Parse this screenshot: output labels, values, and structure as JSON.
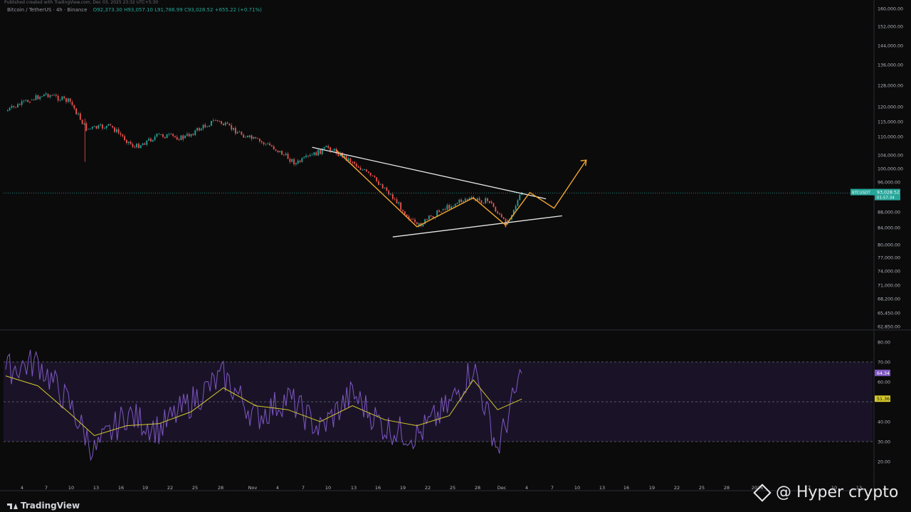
{
  "header": {
    "top_line": "Published created with TradingView.com, Dec 03, 2025 23:32 UTC+5:30",
    "symbol": "Bitcoin / TetherUS · 4h · Binance",
    "o": "O92,373.30",
    "h": "H93,057.10",
    "l": "L91,786.99",
    "c": "C93,028.52",
    "change": "+655.22 (+0.71%)"
  },
  "brand": {
    "logo_text": "TradingView",
    "watermark": "@ Hyper crypto"
  },
  "colors": {
    "background": "#0b0b0b",
    "up": "#26a69a",
    "down": "#ef5350",
    "pattern": "#f0a531",
    "trendline": "#e6e6e6",
    "rsi": "#7e57c2",
    "rsi_ma": "#d4c82b",
    "rsi_band": "#1e1530"
  },
  "price_axis": {
    "ticks": [
      "160,000.00",
      "152,000.00",
      "144,000.00",
      "136,000.00",
      "128,000.00",
      "120,000.00",
      "115,000.00",
      "110,000.00",
      "104,000.00",
      "100,000.00",
      "96,000.00",
      "88,000.00",
      "84,000.00",
      "80,000.00",
      "77,000.00",
      "74,000.00",
      "71,000.00",
      "68,200.00",
      "65,450.00",
      "62,850.00"
    ],
    "current_label": {
      "symbol": "BTCUSDT",
      "price": "93,028.52",
      "countdown": "01:57:34"
    }
  },
  "rsi_axis": {
    "ticks": [
      "80.00",
      "70.00",
      "60.00",
      "40.00",
      "30.00",
      "20.00"
    ],
    "rsi_value": "64.34",
    "ma_value": "51.36"
  },
  "time_axis": {
    "labels": [
      "4",
      "7",
      "10",
      "13",
      "16",
      "19",
      "22",
      "25",
      "28",
      "Nov",
      "4",
      "7",
      "10",
      "13",
      "16",
      "19",
      "22",
      "25",
      "28",
      "Dec",
      "4",
      "7",
      "10",
      "13",
      "16",
      "19",
      "22",
      "25",
      "28",
      "2026",
      "7",
      "10",
      "13"
    ]
  },
  "chart_data": {
    "type": "line",
    "series": [
      {
        "x": [
          "Oct 01",
          "Oct 04",
          "Oct 06",
          "Oct 09",
          "Oct 11",
          "Oct 14",
          "Oct 17",
          "Oct 20",
          "Oct 23",
          "Oct 27",
          "Oct 31",
          "Nov 03",
          "Nov 06",
          "Nov 10",
          "Nov 13",
          "Nov 17",
          "Nov 21",
          "Nov 24",
          "Nov 27",
          "Nov 30",
          "Dec 02",
          "Dec 04"
        ],
        "values": [
          118500,
          122500,
          124800,
          121800,
          112500,
          113500,
          106500,
          110500,
          109500,
          115500,
          109800,
          106800,
          101500,
          106500,
          102000,
          94500,
          84200,
          88500,
          91500,
          90800,
          84800,
          93028
        ]
      }
    ],
    "pattern_path": {
      "x": [
        "Nov 11",
        "Nov 21",
        "Nov 28",
        "Dec 02",
        "Dec 05",
        "Dec 08",
        "Dec 12"
      ],
      "values": [
        105600,
        84200,
        91800,
        84600,
        93200,
        89000,
        102500
      ]
    },
    "trendlines": [
      {
        "x": [
          "Nov 08",
          "Dec 07"
        ],
        "values": [
          106500,
          91500
        ]
      },
      {
        "x": [
          "Nov 18",
          "Dec 09"
        ],
        "values": [
          81800,
          87000
        ]
      }
    ],
    "rsi": {
      "x": [
        "Oct 01",
        "Oct 05",
        "Oct 09",
        "Oct 12",
        "Oct 16",
        "Oct 20",
        "Oct 24",
        "Oct 28",
        "Nov 01",
        "Nov 05",
        "Nov 09",
        "Nov 13",
        "Nov 17",
        "Nov 21",
        "Nov 25",
        "Nov 28",
        "Dec 01",
        "Dec 04"
      ],
      "values": [
        66,
        70,
        48,
        25,
        44,
        36,
        50,
        63,
        42,
        52,
        36,
        54,
        37,
        33,
        48,
        68,
        26,
        64.34
      ],
      "ma": [
        63,
        58,
        44,
        33,
        38,
        39,
        45,
        57,
        48,
        46,
        40,
        48,
        41,
        38,
        43,
        61,
        46,
        51.36
      ]
    },
    "ylim": [
      62850,
      160000
    ],
    "title": "",
    "xlabel": "",
    "ylabel": ""
  }
}
